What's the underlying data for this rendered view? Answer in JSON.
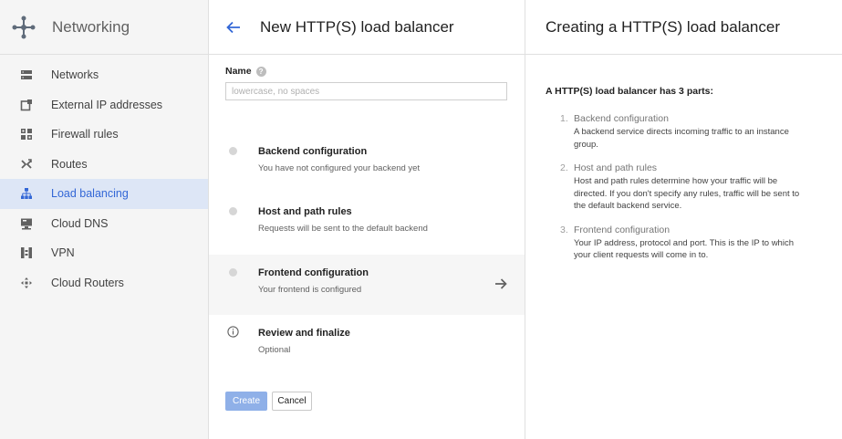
{
  "nav": {
    "title": "Networking",
    "items": [
      {
        "label": "Networks",
        "icon": "networks-icon"
      },
      {
        "label": "External IP addresses",
        "icon": "external-ip-icon"
      },
      {
        "label": "Firewall rules",
        "icon": "firewall-icon"
      },
      {
        "label": "Routes",
        "icon": "routes-icon"
      },
      {
        "label": "Load balancing",
        "icon": "load-balancing-icon",
        "active": true
      },
      {
        "label": "Cloud DNS",
        "icon": "cloud-dns-icon"
      },
      {
        "label": "VPN",
        "icon": "vpn-icon"
      },
      {
        "label": "Cloud Routers",
        "icon": "cloud-routers-icon"
      }
    ]
  },
  "main": {
    "title": "New HTTP(S) load balancer",
    "name_label": "Name",
    "name_value": "",
    "name_placeholder": "lowercase, no spaces",
    "steps": [
      {
        "title": "Backend configuration",
        "subtitle": "You have not configured your backend yet"
      },
      {
        "title": "Host and path rules",
        "subtitle": "Requests will be sent to the default backend"
      },
      {
        "title": "Frontend configuration",
        "subtitle": "Your frontend is configured"
      },
      {
        "title": "Review and finalize",
        "subtitle": "Optional"
      }
    ],
    "create_label": "Create",
    "cancel_label": "Cancel"
  },
  "help_panel": {
    "title": "Creating a HTTP(S) load balancer",
    "intro": "A HTTP(S) load balancer has 3 parts:",
    "parts": [
      {
        "num": "1.",
        "title": "Backend configuration",
        "desc_lines": [
          "A backend service directs incoming traffic to an instance",
          "group."
        ]
      },
      {
        "num": "2.",
        "title": "Host and path rules",
        "desc_lines": [
          "Host and path rules determine how your traffic will be",
          "directed. If you don't specify any rules, traffic will be sent to",
          "the default backend service."
        ]
      },
      {
        "num": "3.",
        "title": "Frontend configuration",
        "desc_lines": [
          "Your IP address, protocol and port. This is the IP to which",
          "your client requests will come in to."
        ]
      }
    ]
  },
  "colors": {
    "accent": "#3367d6",
    "active_bg": "#dde6f6",
    "create_button_bg": "#8fb0e8"
  }
}
